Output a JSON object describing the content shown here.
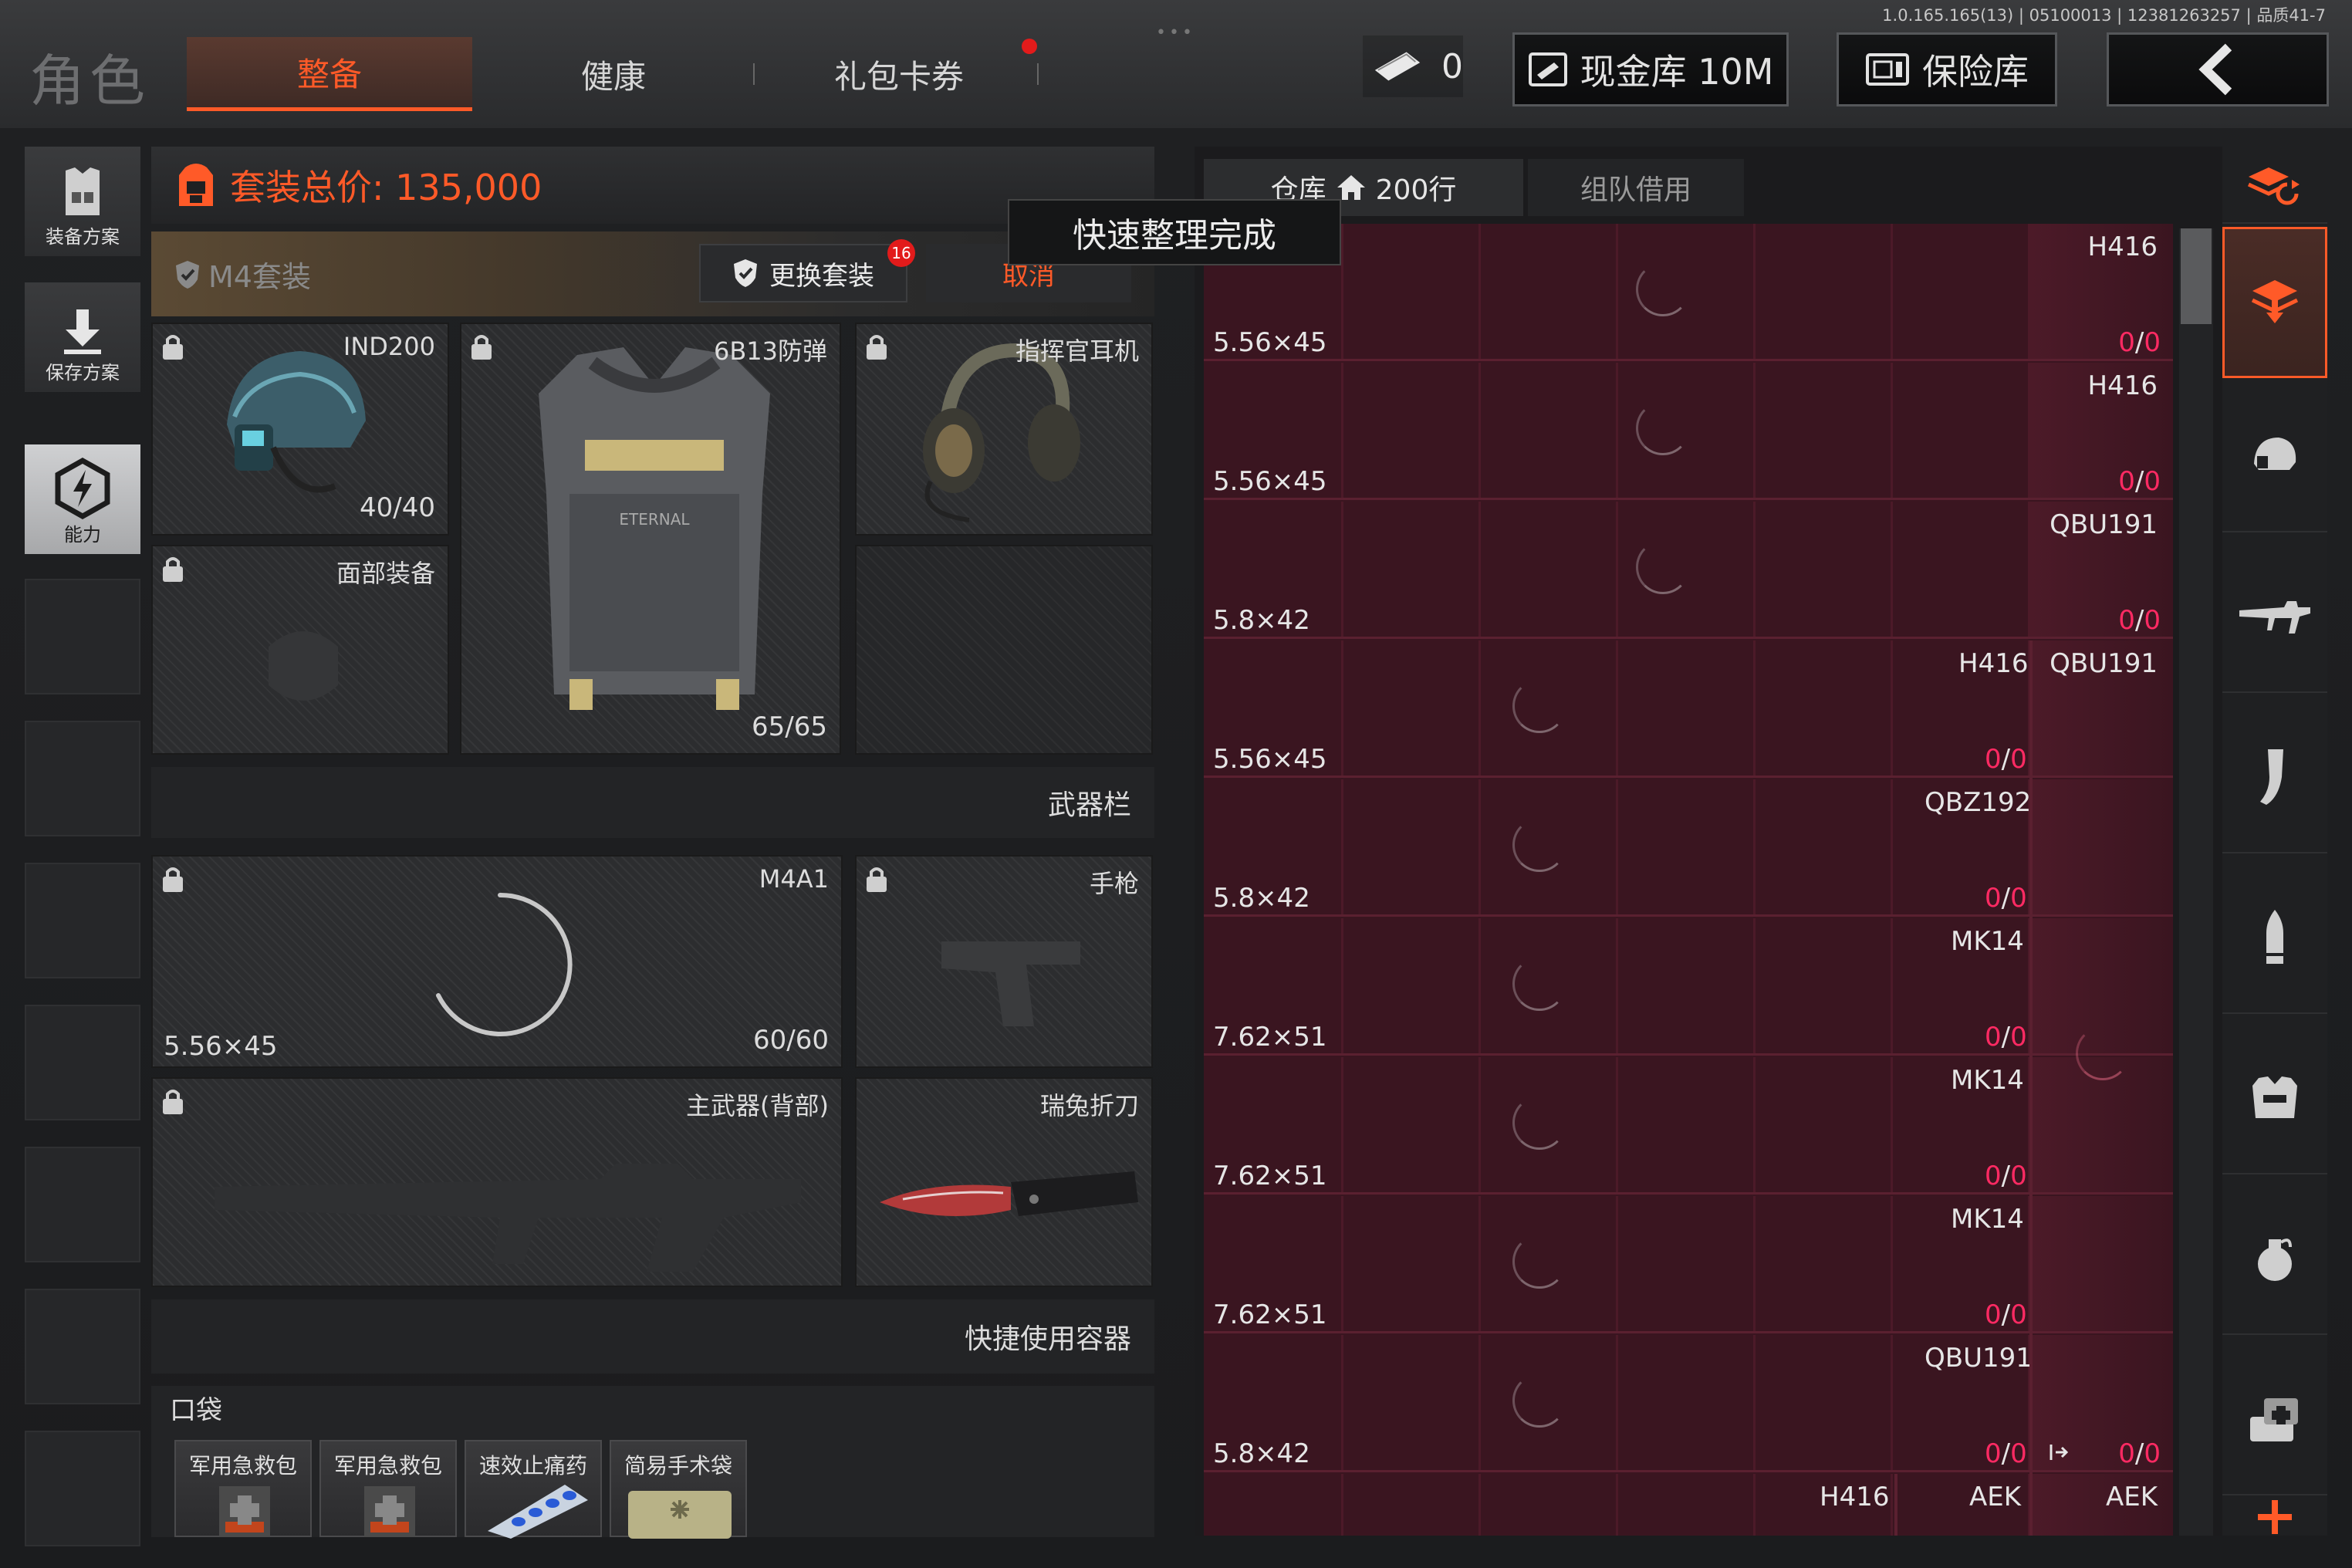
{
  "version_text": "1.0.165.165(13) | 05100013 | 12381263257 | 品质41-7",
  "page_title": "角色",
  "tabs": [
    {
      "label": "整备",
      "active": true
    },
    {
      "label": "健康",
      "active": false
    },
    {
      "label": "礼包卡券",
      "active": false
    }
  ],
  "header": {
    "ticket_count": "0",
    "cash_vault": "现金库 10M",
    "safe_vault": "保险库",
    "back_icon": "chevron-left-icon"
  },
  "left_rail": [
    {
      "label": "装备方案",
      "icon": "vest-plan-icon"
    },
    {
      "label": "保存方案",
      "icon": "download-icon"
    },
    {
      "label": "能力",
      "icon": "ability-icon"
    }
  ],
  "loadout": {
    "total_price_label": "套装总价: 135,000",
    "suit_name": "M4套装",
    "change_suit": "更换套装",
    "change_suit_badge": "16",
    "cancel": "取消",
    "slots": {
      "helmet": {
        "label": "IND200",
        "count": "40/40"
      },
      "armor": {
        "label": "6B13防弹",
        "count": "65/65"
      },
      "headset": {
        "label": "指挥官耳机"
      },
      "face": {
        "label": "面部装备"
      },
      "weapon_bar": "武器栏",
      "primary": {
        "label": "M4A1",
        "caliber": "5.56×45",
        "count": "60/60"
      },
      "pistol": {
        "label": "手枪"
      },
      "back": {
        "label": "主武器(背部)"
      },
      "knife": {
        "label": "瑞兔折刀"
      },
      "quick_container": "快捷使用容器",
      "pocket": "口袋"
    },
    "pocket_items": [
      "军用急救包",
      "军用急救包",
      "速效止痛药",
      "简易手术袋"
    ]
  },
  "warehouse": {
    "tab_storage": "仓库",
    "tab_rows": "200行",
    "tab_team": "组队借用",
    "toast": "快速整理完成",
    "rows": [
      {
        "caliber": "5.56×45",
        "weapons": [
          "H416"
        ],
        "counts": [
          "0/0"
        ]
      },
      {
        "caliber": "5.56×45",
        "weapons": [
          "H416"
        ],
        "counts": [
          "0/0"
        ]
      },
      {
        "caliber": "5.8×42",
        "weapons": [
          "QBU191"
        ],
        "counts": [
          "0/0"
        ]
      },
      {
        "caliber": "5.56×45",
        "weapons": [
          "H416",
          "QBU191"
        ],
        "counts": [
          "0/0"
        ]
      },
      {
        "caliber": "5.8×42",
        "weapons": [
          "QBZ192"
        ],
        "counts": [
          "0/0"
        ]
      },
      {
        "caliber": "7.62×51",
        "weapons": [
          "MK14"
        ],
        "counts": [
          "0/0"
        ]
      },
      {
        "caliber": "7.62×51",
        "weapons": [
          "MK14"
        ],
        "counts": [
          "0/0"
        ]
      },
      {
        "caliber": "7.62×51",
        "weapons": [
          "MK14"
        ],
        "counts": [
          "0/0"
        ]
      },
      {
        "caliber": "5.8×42",
        "weapons": [
          "QBU191"
        ],
        "counts": [
          "0/0",
          "0/0"
        ]
      },
      {
        "caliber": "",
        "weapons": [
          "H416",
          "AEK",
          "AEK"
        ],
        "counts": []
      }
    ]
  },
  "right_rail": [
    {
      "icon": "stack-refresh-icon"
    },
    {
      "icon": "stack-download-icon",
      "active": true
    },
    {
      "icon": "helmet-icon"
    },
    {
      "icon": "rifle-icon"
    },
    {
      "icon": "magazine-icon"
    },
    {
      "icon": "bullet-icon"
    },
    {
      "icon": "armor-icon"
    },
    {
      "icon": "grenade-icon"
    },
    {
      "icon": "medkit-icon"
    },
    {
      "icon": "plus-icon"
    }
  ],
  "colors": {
    "accent": "#ff5a28",
    "count_red": "#ff2a63",
    "grid_bg": "#3a1520"
  }
}
